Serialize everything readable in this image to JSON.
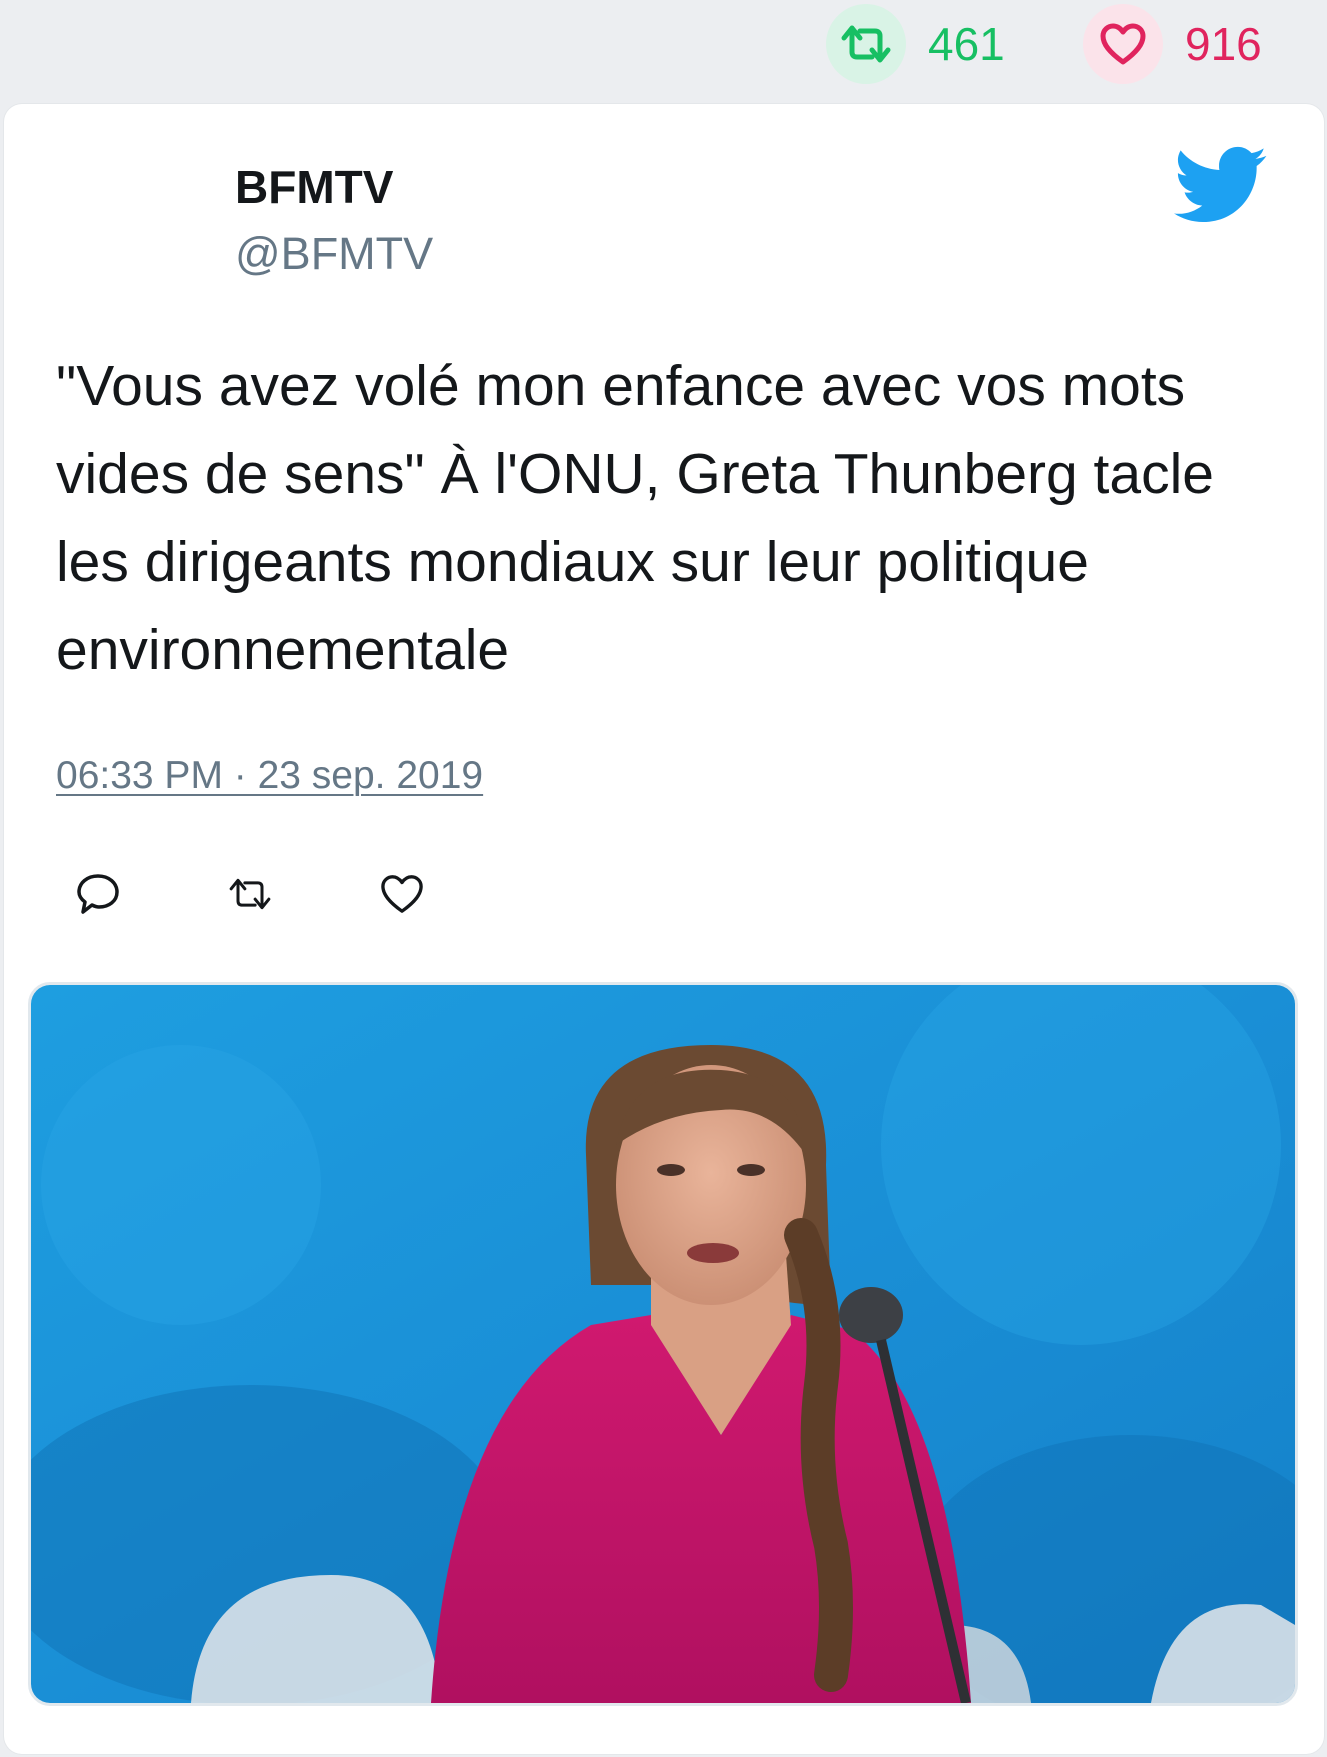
{
  "stats": {
    "retweet_count": "461",
    "like_count": "916",
    "retweet_color": "#17bf63",
    "like_color": "#e0245e"
  },
  "tweet": {
    "author_name": "BFMTV",
    "author_handle": "@BFMTV",
    "text": "\"Vous avez volé mon enfance avec vos mots vides de sens\" À l'ONU, Greta Thunberg tacle les dirigeants mondiaux sur leur politique environnementale",
    "timestamp": "06:33 PM · 23 sep. 2019"
  },
  "icons": {
    "retweet_stat": "retweet-icon",
    "like_stat": "heart-icon",
    "brand": "twitter-bird-icon",
    "reply_action": "reply-icon",
    "retweet_action": "retweet-icon",
    "like_action": "heart-icon"
  },
  "colors": {
    "twitter_blue": "#1da1f2",
    "text_dark": "#14171a",
    "text_muted": "#657786"
  }
}
